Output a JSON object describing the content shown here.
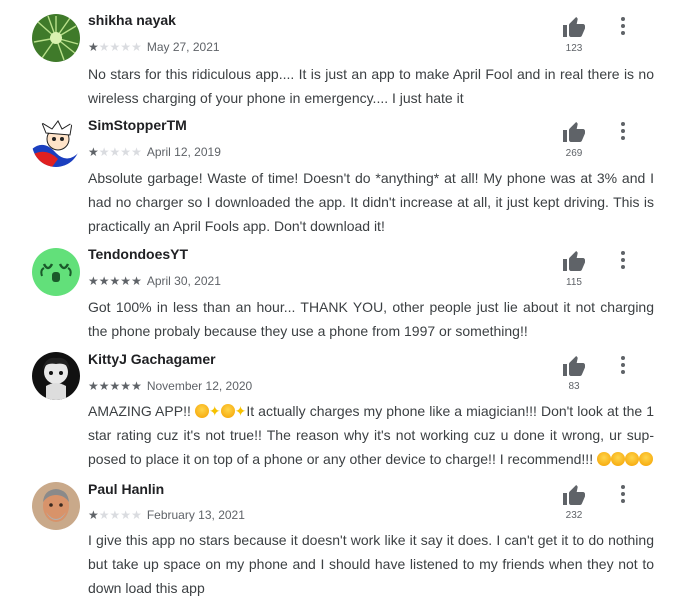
{
  "reviews": [
    {
      "author": "shikha nayak",
      "rating": 1,
      "date": "May 27, 2021",
      "helpful_count": "123",
      "text": "No stars for this ridiculous app.... It is just an app to make April Fool and in real there is no wireless charging of your phone in emergency.... I just hate it"
    },
    {
      "author": "SimStopperTM",
      "rating": 1,
      "date": "April 12, 2019",
      "helpful_count": "269",
      "text": "Absolute garbage! Waste of time! Doesn't do *anything* at all! My phone was at 3% and I had no charger so I downloaded the app. It didn't increase at all, it just kept driving. This is practi­cally an April Fools app. Don't download it!"
    },
    {
      "author": "TendondoesYT",
      "rating": 5,
      "date": "April 30, 2021",
      "helpful_count": "115",
      "text": "Got 100% in less than an hour... THANK YOU, other people just lie about it not charging the phone probaly because they use a phone from 1997 or something!!"
    },
    {
      "author": "KittyJ Gachagamer",
      "rating": 5,
      "date": "November 12, 2020",
      "helpful_count": "83",
      "text_start": "AMAZING APP!! ",
      "text_mid": "It actually charges my phone like a miagician!!! Don't look at the 1 star rating cuz it's not true!! The reason why it's not working cuz u done it wrong, ur sup­posed to place it on top of a phone or any other device to charge!! I recommend!!! "
    },
    {
      "author": "Paul Hanlin",
      "rating": 1,
      "date": "February 13, 2021",
      "helpful_count": "232",
      "text": "I give this app no stars because it doesn't work like it say it does. I can't get it to do nothing but take up space on my phone and I should have listened to my friends when they not to down load this app"
    }
  ],
  "icons": {
    "helpful": "thumbs-up-icon",
    "menu": "more-vert-icon",
    "star": "star-icon"
  },
  "colors": {
    "star_filled": "#5f6368",
    "star_empty": "#dadce0",
    "text": "#3c4043"
  }
}
